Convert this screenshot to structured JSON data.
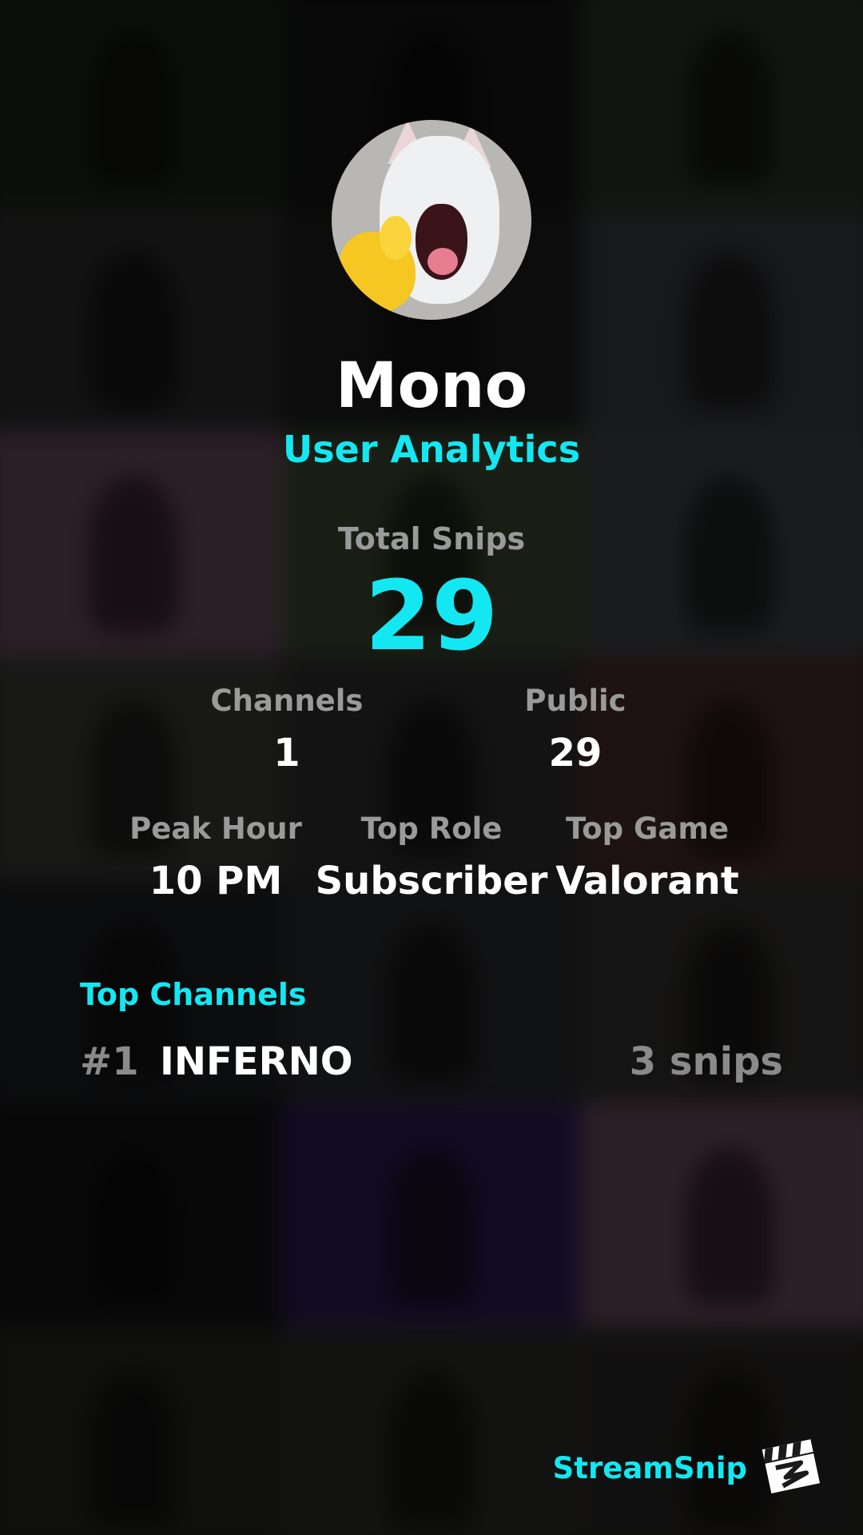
{
  "profile": {
    "name": "Mono",
    "subtitle": "User Analytics"
  },
  "totals": {
    "total_label": "Total Snips",
    "total_value": "29"
  },
  "stats_row1": [
    {
      "label": "Channels",
      "value": "1"
    },
    {
      "label": "Public",
      "value": "29"
    }
  ],
  "stats_row2": [
    {
      "label": "Peak Hour",
      "value": "10 PM"
    },
    {
      "label": "Top Role",
      "value": "Subscriber"
    },
    {
      "label": "Top Game",
      "value": "Valorant"
    }
  ],
  "top_channels": {
    "title": "Top Channels",
    "items": [
      {
        "rank": "#1",
        "name": "INFERNO",
        "count": "3 snips"
      }
    ]
  },
  "branding": {
    "name": "StreamSnip",
    "logo_icon": "clapperboard-icon"
  },
  "colors": {
    "accent": "#13e8f2",
    "muted": "#9a9a9a",
    "text": "#ffffff"
  }
}
